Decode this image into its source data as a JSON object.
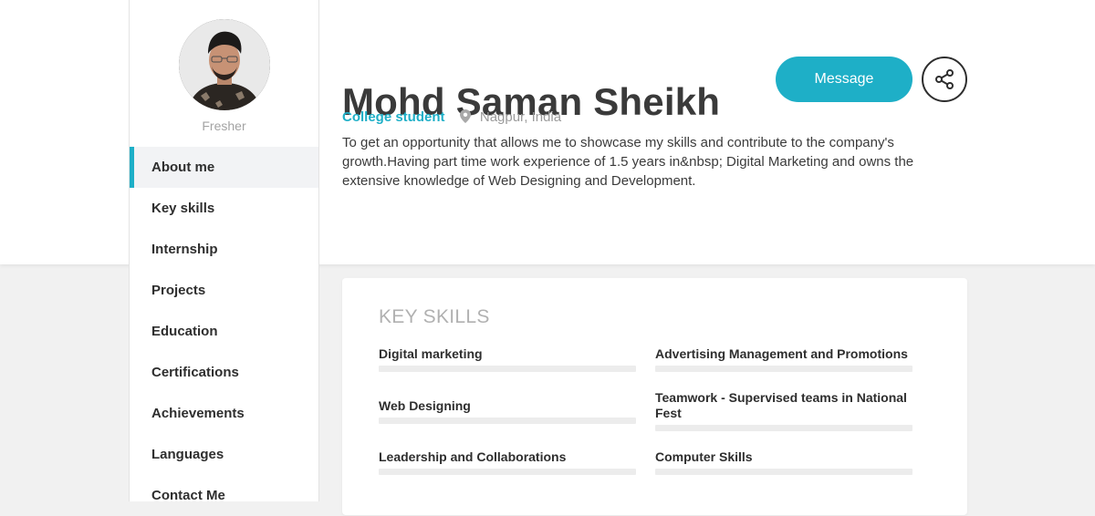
{
  "profile": {
    "name": "Mohd Saman Sheikh",
    "status": "Fresher",
    "role": "College student",
    "location": "Nagpur, India",
    "bio": "To get an opportunity that allows me to showcase my skills and contribute to the company's growth.Having part time work experience of 1.5 years in&nbsp; Digital Marketing and owns the extensive knowledge of Web Designing and Development."
  },
  "actions": {
    "message_label": "Message",
    "share_icon": "share-icon"
  },
  "sidebar": {
    "items": [
      {
        "label": "About me",
        "active": true
      },
      {
        "label": "Key skills",
        "active": false
      },
      {
        "label": "Internship",
        "active": false
      },
      {
        "label": "Projects",
        "active": false
      },
      {
        "label": "Education",
        "active": false
      },
      {
        "label": "Certifications",
        "active": false
      },
      {
        "label": "Achievements",
        "active": false
      },
      {
        "label": "Languages",
        "active": false
      },
      {
        "label": "Contact Me",
        "active": false
      }
    ]
  },
  "key_skills": {
    "title": "KEY SKILLS",
    "items": [
      "Digital marketing",
      "Advertising Management and Promotions",
      "Web Designing",
      "Teamwork - Supervised teams in National Fest",
      "Leadership and Collaborations",
      "Computer Skills"
    ]
  },
  "colors": {
    "accent": "#1eafc7",
    "text_dark": "#2e2e2e",
    "text_muted": "#9a9a9a",
    "page_bg": "#f1f1f1"
  }
}
